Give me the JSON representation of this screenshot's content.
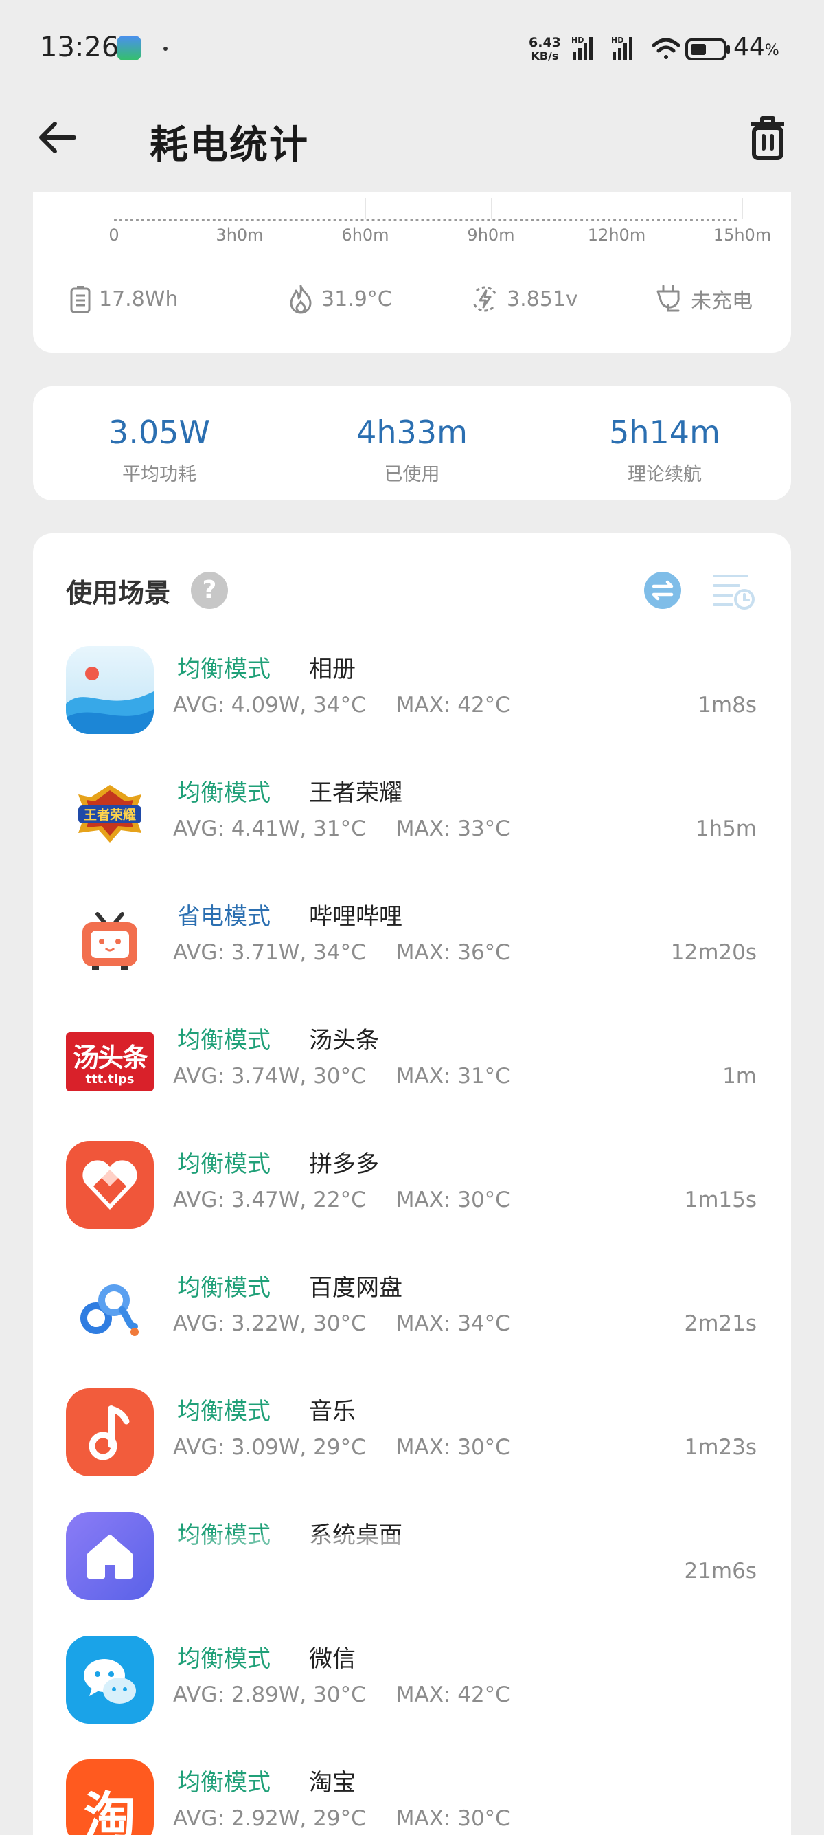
{
  "status_bar": {
    "time": "13:26",
    "net_speed_value": "6.43",
    "net_speed_unit": "KB/s",
    "battery_percent": "44",
    "battery_percent_sign": "%"
  },
  "header": {
    "title": "耗电统计"
  },
  "chart": {
    "x_ticks": [
      "0",
      "3h0m",
      "6h0m",
      "9h0m",
      "12h0m",
      "15h0m"
    ],
    "stats": {
      "energy": "17.8Wh",
      "temperature": "31.9°C",
      "voltage": "3.851v",
      "charging": "未充电"
    }
  },
  "summary": {
    "avg_power": {
      "value": "3.05W",
      "label": "平均功耗"
    },
    "used": {
      "value": "4h33m",
      "label": "已使用"
    },
    "remaining": {
      "value": "5h14m",
      "label": "理论续航"
    }
  },
  "scenes": {
    "title": "使用场景",
    "help": "?",
    "items": [
      {
        "icon": "gallery-icon",
        "mode": "均衡模式",
        "name": "相册",
        "avg": "AVG: 4.09W, 34°C",
        "max": "MAX:  42°C",
        "duration": "1m8s"
      },
      {
        "icon": "honor-of-kings-icon",
        "mode": "均衡模式",
        "name": "王者荣耀",
        "avg": "AVG: 4.41W, 31°C",
        "max": "MAX:  33°C",
        "duration": "1h5m"
      },
      {
        "icon": "bilibili-icon",
        "mode": "省电模式",
        "name": "哔哩哔哩",
        "avg": "AVG: 3.71W, 34°C",
        "max": "MAX:  36°C",
        "duration": "12m20s"
      },
      {
        "icon": "tangtoutiao-icon",
        "mode": "均衡模式",
        "name": "汤头条",
        "avg": "AVG: 3.74W, 30°C",
        "max": "MAX:  31°C",
        "duration": "1m"
      },
      {
        "icon": "pinduoduo-icon",
        "mode": "均衡模式",
        "name": "拼多多",
        "avg": "AVG: 3.47W, 22°C",
        "max": "MAX:  30°C",
        "duration": "1m15s"
      },
      {
        "icon": "baidu-netdisk-icon",
        "mode": "均衡模式",
        "name": "百度网盘",
        "avg": "AVG: 3.22W, 30°C",
        "max": "MAX:  34°C",
        "duration": "2m21s"
      },
      {
        "icon": "music-icon",
        "mode": "均衡模式",
        "name": "音乐",
        "avg": "AVG: 3.09W, 29°C",
        "max": "MAX:  30°C",
        "duration": "1m23s"
      },
      {
        "icon": "system-launcher-icon",
        "mode": "均衡模式",
        "name": "系统桌面",
        "avg": "",
        "max": "",
        "duration": "21m6s"
      },
      {
        "icon": "wechat-icon",
        "mode": "均衡模式",
        "name": "微信",
        "avg": "AVG: 2.89W, 30°C",
        "max": "MAX:  42°C",
        "duration": ""
      },
      {
        "icon": "taobao-icon",
        "mode": "均衡模式",
        "name": "淘宝",
        "avg": "AVG: 2.92W, 29°C",
        "max": "MAX:  30°C",
        "duration": ""
      }
    ],
    "taobao_glyph": "淘",
    "tangtoutiao_glyph": "汤头条",
    "tangtoutiao_sub": "ttt.tips"
  },
  "colors": {
    "balanced_mode": "#20a078",
    "save_mode": "#2b6fb1",
    "accent_blue": "#2b6fb1"
  }
}
